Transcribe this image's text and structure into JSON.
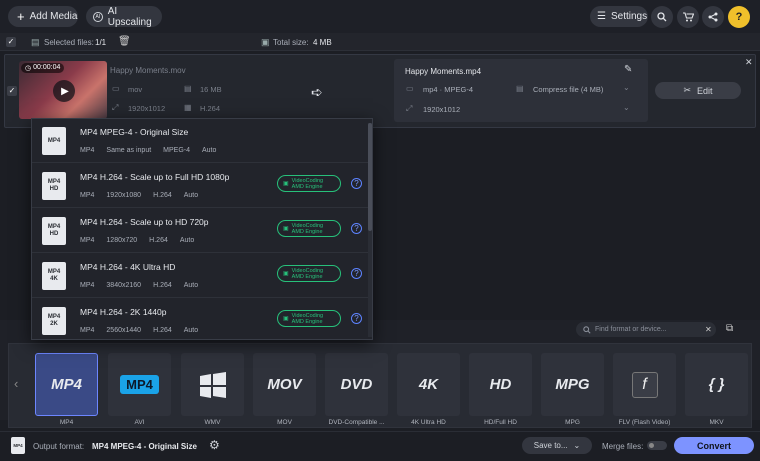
{
  "topbar": {
    "add_media": "Add Media",
    "ai_upscaling": "AI Upscaling",
    "settings": "Settings"
  },
  "subbar": {
    "selected_label": "Selected files:",
    "selected_value": "1/1",
    "total_label": "Total size:",
    "total_value": "4 MB"
  },
  "file": {
    "duration": "00:00:04",
    "name": "Happy Moments.mov",
    "format": "mov",
    "size": "16 MB",
    "resolution": "1920x1012",
    "codec": "H.264"
  },
  "output": {
    "name": "Happy Moments.mp4",
    "format": "mp4 · MPEG-4",
    "compress": "Compress file (4 MB)",
    "resolution": "1920x1012",
    "edit_label": "Edit"
  },
  "dropdown": {
    "items": [
      {
        "icon_top": "MP4",
        "icon_bottom": "",
        "title": "MP4 MPEG-4 - Original Size",
        "meta": [
          "MP4",
          "Same as input",
          "MPEG-4",
          "Auto"
        ],
        "badge": false
      },
      {
        "icon_top": "MP4",
        "icon_bottom": "HD",
        "title": "MP4 H.264 - Scale up to Full HD 1080p",
        "meta": [
          "MP4",
          "1920x1080",
          "H.264",
          "Auto"
        ],
        "badge": true
      },
      {
        "icon_top": "MP4",
        "icon_bottom": "HD",
        "title": "MP4 H.264 - Scale up to HD 720p",
        "meta": [
          "MP4",
          "1280x720",
          "H.264",
          "Auto"
        ],
        "badge": true
      },
      {
        "icon_top": "MP4",
        "icon_bottom": "4K",
        "title": "MP4 H.264 - 4K Ultra HD",
        "meta": [
          "MP4",
          "3840x2160",
          "H.264",
          "Auto"
        ],
        "badge": true
      },
      {
        "icon_top": "MP4",
        "icon_bottom": "2K",
        "title": "MP4 H.264 - 2K 1440p",
        "meta": [
          "MP4",
          "2560x1440",
          "H.264",
          "Auto"
        ],
        "badge": true
      }
    ],
    "badge_line1": "VideoCoding",
    "badge_line2": "AMD Engine"
  },
  "search": {
    "placeholder": "Find format or device..."
  },
  "formats": [
    {
      "logo": "MP4",
      "label": "MP4",
      "selected": true
    },
    {
      "logo": "MP4",
      "label": "AVI",
      "selected": false
    },
    {
      "logo": "",
      "label": "WMV",
      "selected": false
    },
    {
      "logo": "MOV",
      "label": "MOV",
      "selected": false
    },
    {
      "logo": "DVD",
      "label": "DVD-Compatible ...",
      "selected": false
    },
    {
      "logo": "4K",
      "label": "4K Ultra HD",
      "selected": false
    },
    {
      "logo": "HD",
      "label": "HD/Full HD",
      "selected": false
    },
    {
      "logo": "MPG",
      "label": "MPG",
      "selected": false
    },
    {
      "logo": "",
      "label": "FLV (Flash Video)",
      "selected": false
    },
    {
      "logo": "{ }",
      "label": "MKV",
      "selected": false
    }
  ],
  "bottom": {
    "output_format_label": "Output format:",
    "output_format_value": "MP4 MPEG-4 - Original Size",
    "save_to": "Save to...",
    "merge_files": "Merge files:",
    "convert": "Convert"
  }
}
